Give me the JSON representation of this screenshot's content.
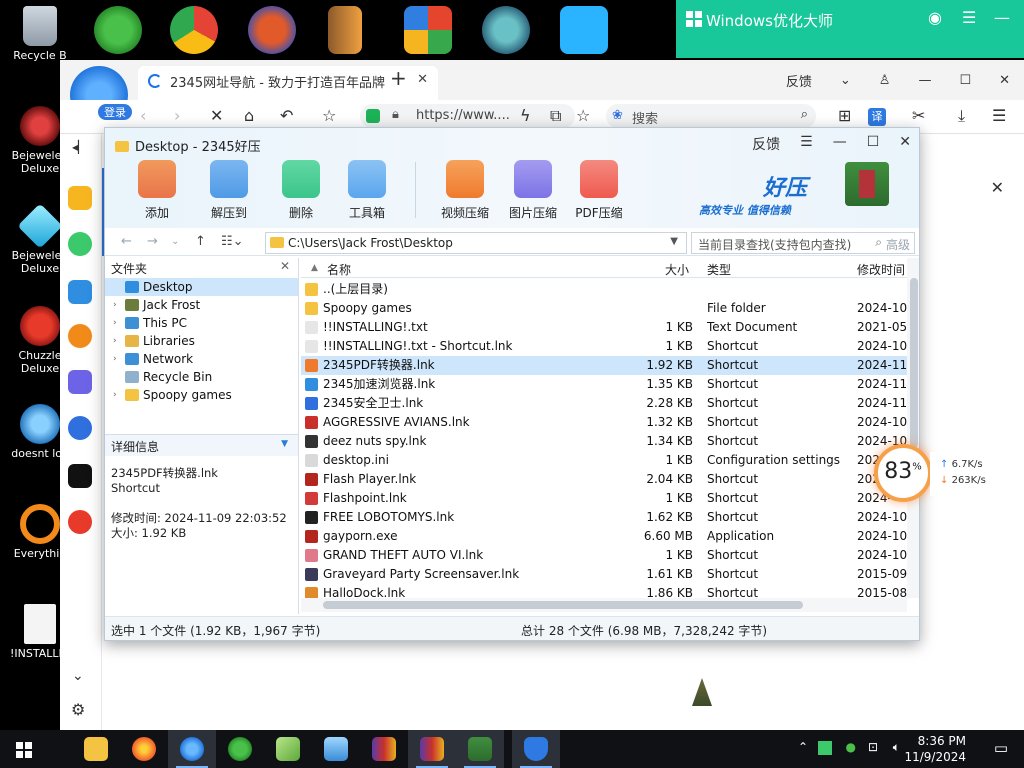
{
  "desktop": {
    "icons": [
      {
        "label": "Recycle B"
      },
      {
        "label": "Bejeweled Deluxe"
      },
      {
        "label": "Bejeweled Deluxe"
      },
      {
        "label": "Chuzzle Deluxe"
      },
      {
        "label": "doesnt loa"
      },
      {
        "label": "Everythin"
      },
      {
        "label": "!INSTALLIN"
      }
    ]
  },
  "optimizer": {
    "title": "Windows优化大师"
  },
  "browser": {
    "tab_title": "2345网址导航 - 致力于打造百年品牌",
    "feedback": "反馈",
    "url": "https://www....",
    "search_placeholder": "搜索"
  },
  "zip": {
    "title": "Desktop - 2345好压",
    "feedback": "反馈",
    "toolbar": [
      {
        "label": "添加",
        "color": "#e9744a"
      },
      {
        "label": "解压到",
        "color": "#4f9ae6"
      },
      {
        "label": "删除",
        "color": "#3cc58a"
      },
      {
        "label": "工具箱",
        "color": "#5aa6ee"
      },
      {
        "label": "视频压缩",
        "color": "#f07a2c"
      },
      {
        "label": "图片压缩",
        "color": "#7d73e6"
      },
      {
        "label": "PDF压缩",
        "color": "#ef5a4f"
      }
    ],
    "brand_big": "好压",
    "brand_small": "高效专业 值得信赖",
    "path": "C:\\Users\\Jack Frost\\Desktop",
    "find_placeholder": "当前目录查找(支持包内查找)",
    "advanced": "高级",
    "left_header": "文件夹",
    "tree": [
      {
        "label": "Desktop",
        "arrow": "",
        "color": "#2f8ee0",
        "selected": true
      },
      {
        "label": "Jack Frost",
        "arrow": "›",
        "color": "#6a7d3a"
      },
      {
        "label": "This PC",
        "arrow": "›",
        "color": "#3d8fd6"
      },
      {
        "label": "Libraries",
        "arrow": "›",
        "color": "#e5b546"
      },
      {
        "label": "Network",
        "arrow": "›",
        "color": "#3d8fd6"
      },
      {
        "label": "Recycle Bin",
        "arrow": "",
        "color": "#8fb1cc"
      },
      {
        "label": "Spoopy games",
        "arrow": "›",
        "color": "#f5c342"
      }
    ],
    "detail_header": "详细信息",
    "detail": {
      "name": "2345PDF转换器.lnk",
      "type": "Shortcut",
      "modified": "修改时间: 2024-11-09 22:03:52",
      "size": "大小: 1.92 KB"
    },
    "columns": {
      "name": "名称",
      "size": "大小",
      "type": "类型",
      "date": "修改时间"
    },
    "files": [
      {
        "name": "..(上层目录)",
        "size": "",
        "type": "",
        "date": "",
        "color": "#f5c342"
      },
      {
        "name": "Spoopy games",
        "size": "",
        "type": "File folder",
        "date": "2024-10-",
        "color": "#f5c342"
      },
      {
        "name": "!!INSTALLING!.txt",
        "size": "1 KB",
        "type": "Text Document",
        "date": "2021-05-",
        "color": "#e6e6e6"
      },
      {
        "name": "!!INSTALLING!.txt - Shortcut.lnk",
        "size": "1 KB",
        "type": "Shortcut",
        "date": "2024-10-",
        "color": "#e6e6e6"
      },
      {
        "name": "2345PDF转换器.lnk",
        "size": "1.92 KB",
        "type": "Shortcut",
        "date": "2024-11-",
        "color": "#f07a2c",
        "selected": true
      },
      {
        "name": "2345加速浏览器.lnk",
        "size": "1.35 KB",
        "type": "Shortcut",
        "date": "2024-11-",
        "color": "#2f8ee0"
      },
      {
        "name": "2345安全卫士.lnk",
        "size": "2.28 KB",
        "type": "Shortcut",
        "date": "2024-11-",
        "color": "#2f6fde"
      },
      {
        "name": "AGGRESSIVE AVIANS.lnk",
        "size": "1.32 KB",
        "type": "Shortcut",
        "date": "2024-10-",
        "color": "#c9302c"
      },
      {
        "name": "deez nuts spy.lnk",
        "size": "1.34 KB",
        "type": "Shortcut",
        "date": "2024-10-",
        "color": "#333333"
      },
      {
        "name": "desktop.ini",
        "size": "1 KB",
        "type": "Configuration settings",
        "date": "2024-",
        "color": "#d9d9d9"
      },
      {
        "name": "Flash Player.lnk",
        "size": "2.04 KB",
        "type": "Shortcut",
        "date": "2024-",
        "color": "#b3261e"
      },
      {
        "name": "Flashpoint.lnk",
        "size": "1 KB",
        "type": "Shortcut",
        "date": "2024-",
        "color": "#d33b3b"
      },
      {
        "name": "FREE LOBOTOMYS.lnk",
        "size": "1.62 KB",
        "type": "Shortcut",
        "date": "2024-10-",
        "color": "#222222"
      },
      {
        "name": "gayporn.exe",
        "size": "6.60 MB",
        "type": "Application",
        "date": "2024-10-",
        "color": "#b3261e"
      },
      {
        "name": "GRAND THEFT AUTO VI.lnk",
        "size": "1 KB",
        "type": "Shortcut",
        "date": "2024-10-",
        "color": "#e07a8a"
      },
      {
        "name": "Graveyard Party Screensaver.lnk",
        "size": "1.61 KB",
        "type": "Shortcut",
        "date": "2015-09-",
        "color": "#3a3a5a"
      },
      {
        "name": "HalloDock.lnk",
        "size": "1.86 KB",
        "type": "Shortcut",
        "date": "2015-08-",
        "color": "#e08a2c"
      }
    ],
    "status_left": "选中 1 个文件 (1.92 KB，1,967 字节)",
    "status_right": "总计 28 个文件 (6.98 MB，7,328,242 字节)"
  },
  "speed_widget": {
    "percent": "83",
    "percent_sign": "%",
    "up": "6.7",
    "up_unit": "K/s",
    "down": "263",
    "down_unit": "K/s"
  },
  "taskbar": {
    "time": "8:36 PM",
    "date": "11/9/2024"
  }
}
